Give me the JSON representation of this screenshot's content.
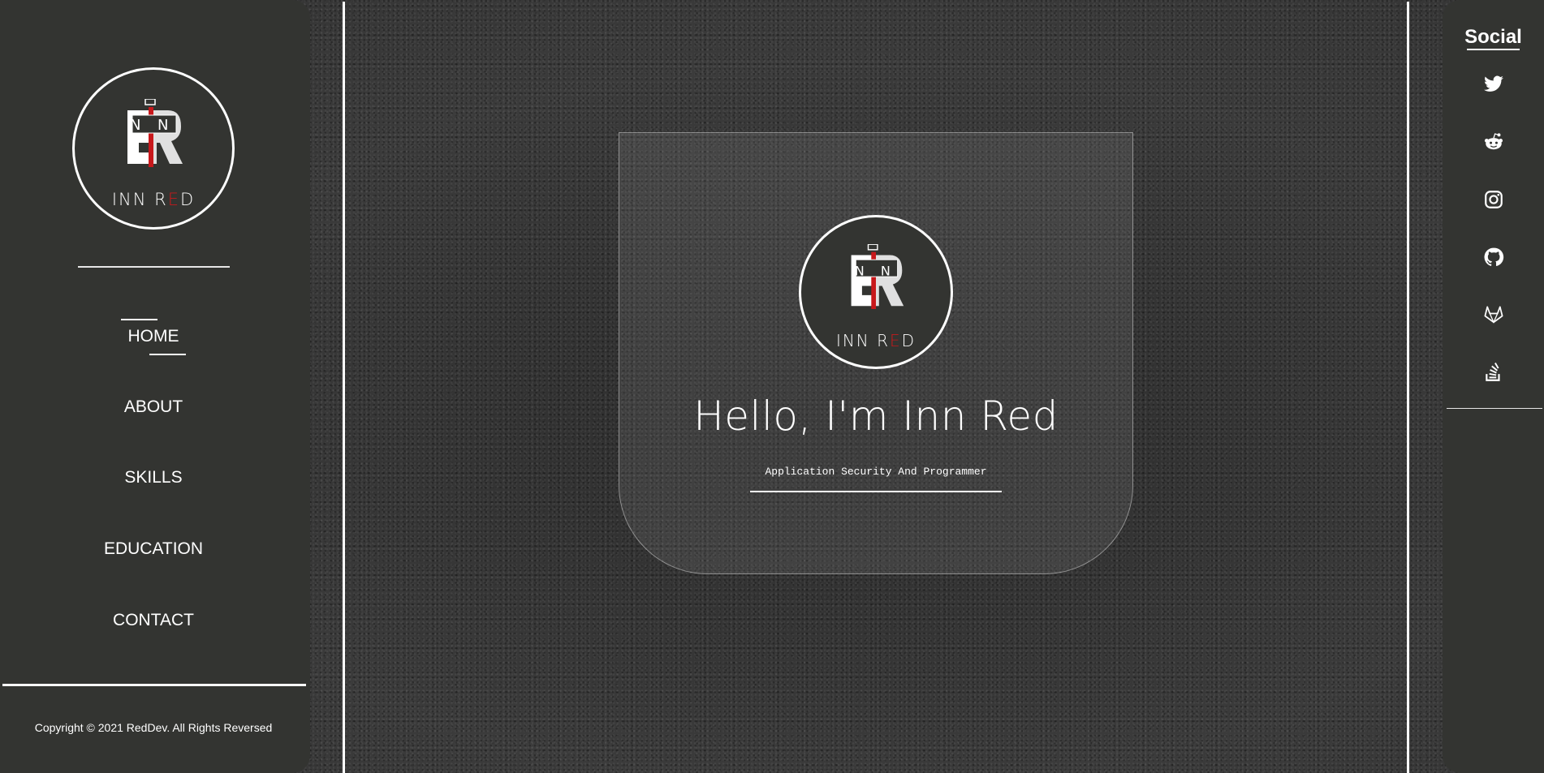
{
  "logo": {
    "text_main": "INN R",
    "text_accent": "E",
    "text_end": "D",
    "mark_letters": "NN"
  },
  "nav": {
    "items": [
      {
        "label": "HOME",
        "active": true
      },
      {
        "label": "ABOUT",
        "active": false
      },
      {
        "label": "SKILLS",
        "active": false
      },
      {
        "label": "EDUCATION",
        "active": false
      },
      {
        "label": "CONTACT",
        "active": false
      }
    ]
  },
  "footer": {
    "copyright": "Copyright © 2021 RedDev. All Rights Reversed"
  },
  "hero": {
    "title": "Hello, I'm Inn Red",
    "subtitle": "Application Security And Programmer"
  },
  "social": {
    "title": "Social",
    "icons": [
      "twitter-icon",
      "reddit-icon",
      "instagram-icon",
      "github-icon",
      "gitlab-icon",
      "stackoverflow-icon"
    ]
  },
  "colors": {
    "accent": "#c8181b",
    "panel": "#333431",
    "text": "#ffffff"
  }
}
